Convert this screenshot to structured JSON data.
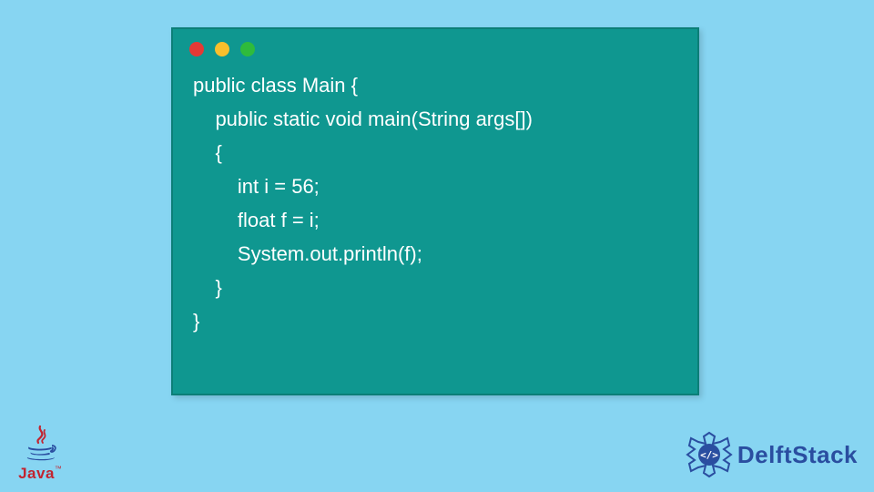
{
  "code_window": {
    "traffic_lights": [
      "red",
      "yellow",
      "green"
    ],
    "lines": [
      "public class Main {",
      "    public static void main(String args[])",
      "    {",
      "        int i = 56;",
      "        float f = i;",
      "        System.out.println(f);",
      "    }",
      "}"
    ]
  },
  "logos": {
    "java": {
      "label": "Java",
      "tm": "™"
    },
    "delftstack": {
      "label": "DelftStack"
    }
  },
  "colors": {
    "background": "#87d5f2",
    "window": "#0f9790",
    "java_red": "#c22430",
    "delft_blue": "#2a4ea0"
  }
}
